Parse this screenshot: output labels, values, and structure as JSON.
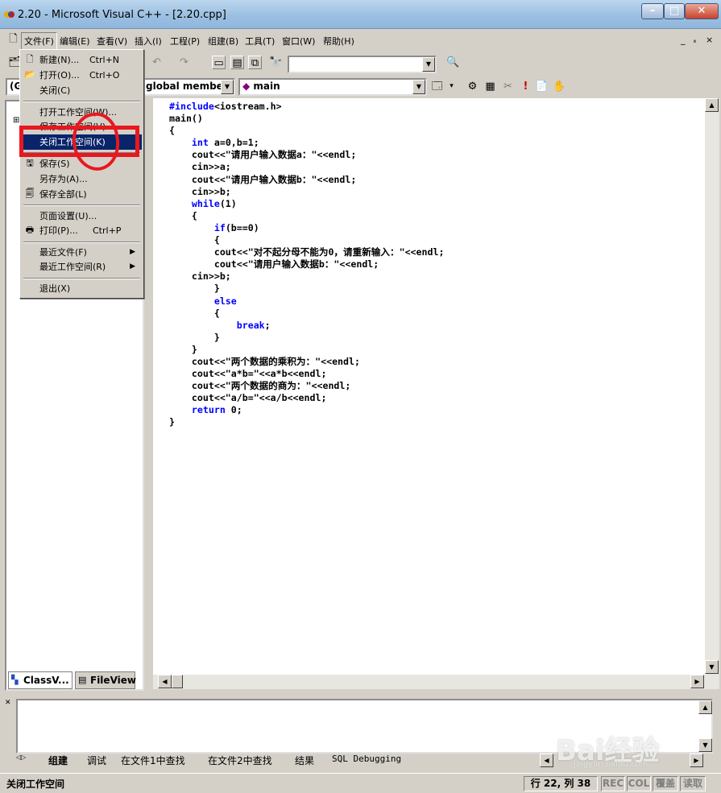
{
  "window": {
    "title": "2.20 - Microsoft Visual C++ - [2.20.cpp]",
    "min": "–",
    "max": "□",
    "close": "✕"
  },
  "menubar": {
    "items": [
      "文件(F)",
      "编辑(E)",
      "查看(V)",
      "插入(I)",
      "工程(P)",
      "组建(B)",
      "工具(T)",
      "窗口(W)",
      "帮助(H)"
    ],
    "mdi_controls": [
      "_",
      "ₓ",
      "×"
    ]
  },
  "toolbar": {
    "find_combo_value": "",
    "class_combo_value": "(G",
    "members_combo_value": "global members",
    "function_combo_value": "main"
  },
  "file_menu": {
    "items": [
      {
        "label": "新建(N)...",
        "shortcut": "Ctrl+N",
        "icon": "new-file-icon"
      },
      {
        "label": "打开(O)...",
        "shortcut": "Ctrl+O",
        "icon": "open-folder-icon"
      },
      {
        "label": "关闭(C)",
        "shortcut": "",
        "icon": ""
      },
      {
        "label": "打开工作空间(W)...",
        "shortcut": "",
        "icon": ""
      },
      {
        "label": "保存工作空间(V)",
        "shortcut": "",
        "icon": ""
      },
      {
        "label": "关闭工作空间(K)",
        "shortcut": "",
        "icon": ""
      },
      {
        "label": "保存(S)",
        "shortcut": "",
        "icon": "save-icon"
      },
      {
        "label": "另存为(A)...",
        "shortcut": "",
        "icon": ""
      },
      {
        "label": "保存全部(L)",
        "shortcut": "",
        "icon": "save-all-icon"
      },
      {
        "label": "页面设置(U)...",
        "shortcut": "",
        "icon": ""
      },
      {
        "label": "打印(P)...",
        "shortcut": "Ctrl+P",
        "icon": "print-icon"
      },
      {
        "label": "最近文件(F)",
        "shortcut": "",
        "icon": ""
      },
      {
        "label": "最近工作空间(R)",
        "shortcut": "",
        "icon": ""
      },
      {
        "label": "退出(X)",
        "shortcut": "",
        "icon": ""
      }
    ],
    "highlighted_index": 5
  },
  "code_lines": [
    "#include<iostream.h>",
    "main()",
    "{",
    "    int a=0,b=1;",
    "    cout<<\"请用户输入数据a：\"<<endl;",
    "    cin>>a;",
    "    cout<<\"请用户输入数据b：\"<<endl;",
    "    cin>>b;",
    "    while(1)",
    "    {",
    "        if(b==0)",
    "        {",
    "        cout<<\"对不起分母不能为0，请重新输入：\"<<endl;",
    "        cout<<\"请用户输入数据b：\"<<endl;",
    "    cin>>b;",
    "        }",
    "        else",
    "        {",
    "            break;",
    "        }",
    "    }",
    "    cout<<\"两个数据的乘积为：\"<<endl;",
    "    cout<<\"a*b=\"<<a*b<<endl;",
    "    cout<<\"两个数据的商为：\"<<endl;",
    "    cout<<\"a/b=\"<<a/b<<endl;",
    "    return 0;",
    "}"
  ],
  "workspace_tabs": [
    "ClassV...",
    "FileView"
  ],
  "output_tabs": [
    "组建",
    "调试",
    "在文件1中查找",
    "在文件2中查找",
    "结果",
    "SQL Debugging"
  ],
  "status": {
    "message": "关闭工作空间",
    "position": "行 22, 列 38",
    "rec": "REC",
    "col": "COL",
    "ovr": "覆盖",
    "read": "读取"
  },
  "watermark": {
    "brand": "Bai经验",
    "url": "jingyan.baidu.com"
  },
  "colors": {
    "keyword": "#0000ff",
    "highlight": "#0a246a",
    "annotation": "#e8181e"
  }
}
